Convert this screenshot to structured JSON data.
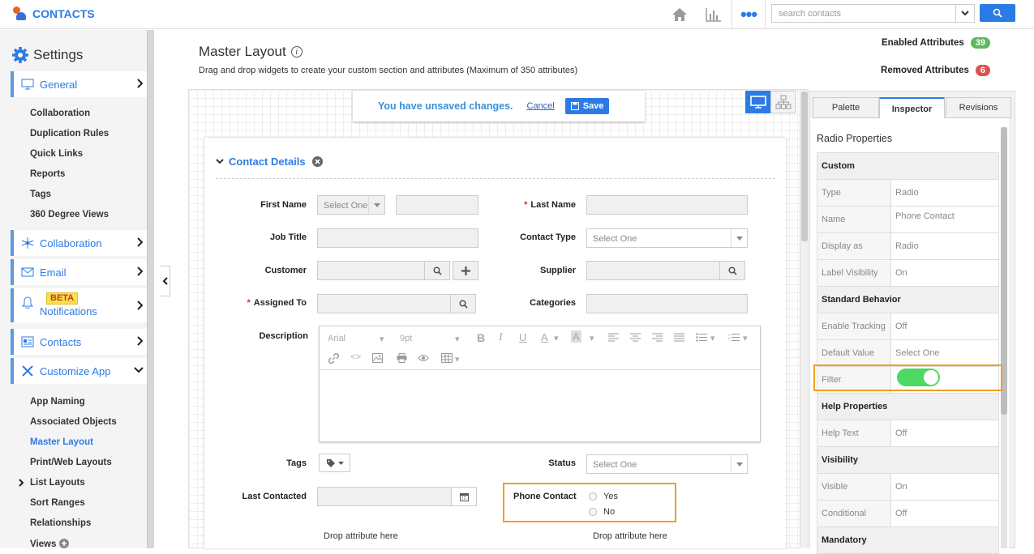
{
  "app": {
    "title": "CONTACTS"
  },
  "topbar": {
    "search_placeholder": "search contacts"
  },
  "sidebar": {
    "title": "Settings",
    "groups": [
      {
        "label": "General"
      },
      {
        "label": "Collaboration"
      },
      {
        "label": "Email"
      },
      {
        "label": "Notifications",
        "badge": "BETA"
      },
      {
        "label": "Contacts"
      },
      {
        "label": "Customize App"
      }
    ],
    "general_items": [
      "Collaboration",
      "Duplication Rules",
      "Quick Links",
      "Reports",
      "Tags",
      "360 Degree Views"
    ],
    "customize_items": [
      "App Naming",
      "Associated Objects",
      "Master Layout",
      "Print/Web Layouts",
      "List Layouts",
      "Sort Ranges",
      "Relationships",
      "Views"
    ]
  },
  "main": {
    "title": "Master Layout",
    "subtitle": "Drag and drop widgets to create your custom section and attributes (Maximum of 350 attributes)",
    "enabled_label": "Enabled Attributes",
    "enabled_count": "39",
    "removed_label": "Removed Attributes",
    "removed_count": "6"
  },
  "unsaved": {
    "message": "You have unsaved changes.",
    "cancel": "Cancel",
    "save": "Save"
  },
  "form": {
    "section_title": "Contact Details",
    "labels": {
      "first_name": "First Name",
      "last_name": "Last Name",
      "job_title": "Job Title",
      "contact_type": "Contact Type",
      "customer": "Customer",
      "supplier": "Supplier",
      "assigned_to": "Assigned To",
      "categories": "Categories",
      "description": "Description",
      "tags": "Tags",
      "status": "Status",
      "last_contacted": "Last Contacted",
      "phone_contact": "Phone Contact"
    },
    "select_one": "Select One",
    "editor": {
      "font": "Arial",
      "size": "9pt"
    },
    "radio_options": [
      "Yes",
      "No"
    ],
    "drop_text": "Drop attribute here"
  },
  "panel": {
    "tabs": [
      "Palette",
      "Inspector",
      "Revisions"
    ],
    "active_tab": "Inspector",
    "title": "Radio Properties",
    "rows": [
      {
        "section": "Custom"
      },
      {
        "key": "Type",
        "value": "Radio"
      },
      {
        "key": "Name",
        "value": "Phone Contact"
      },
      {
        "key": "Display as",
        "value": "Radio"
      },
      {
        "key": "Label Visibility",
        "value": "On"
      },
      {
        "section": "Standard Behavior"
      },
      {
        "key": "Enable Tracking",
        "value": "Off"
      },
      {
        "key": "Default Value",
        "value": "Select One"
      },
      {
        "key": "Filter",
        "value": ""
      },
      {
        "section": "Help Properties"
      },
      {
        "key": "Help Text",
        "value": "Off"
      },
      {
        "section": "Visibility"
      },
      {
        "key": "Visible",
        "value": "On"
      },
      {
        "key": "Conditional",
        "value": "Off"
      },
      {
        "section": "Mandatory"
      }
    ],
    "filter_on": true
  },
  "colors": {
    "accent": "#2c7be5",
    "enabled": "#5cb85c",
    "removed": "#d9534f",
    "highlight": "#f0a020",
    "toggle": "#4cd964"
  }
}
